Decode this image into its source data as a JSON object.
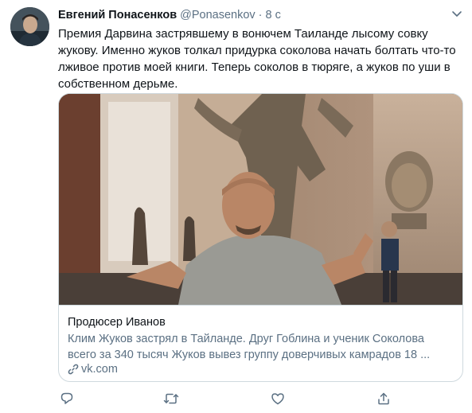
{
  "tweet": {
    "display_name": "Евгений Понасенков",
    "handle": "@Ponasenkov",
    "separator": "·",
    "time": "8 с",
    "text": "Премия Дарвина застрявшему в вонючем Таиланде лысому совку\nжукову. Именно жуков толкал придурка соколова начать болтать что-то\nлживое против моей книги. Теперь соколов в тюряге, а жуков по уши в\nсобственном дерьме."
  },
  "card": {
    "title": "Продюсер Иванов",
    "description": "Клим Жуков застрял в Тайланде. Друг Гоблина и ученик Соколова\nвсего за 340 тысяч Жуков вывез группу доверчивых камрадов 18 ...",
    "domain": "vk.com"
  },
  "icons": {
    "caret": "chevron-down-icon",
    "link": "link-icon",
    "reply": "reply-icon",
    "retweet": "retweet-icon",
    "like": "heart-icon",
    "share": "share-icon"
  },
  "colors": {
    "secondary_text": "#5b7083",
    "border": "#cfd9de",
    "primary_text": "#0f1419"
  }
}
